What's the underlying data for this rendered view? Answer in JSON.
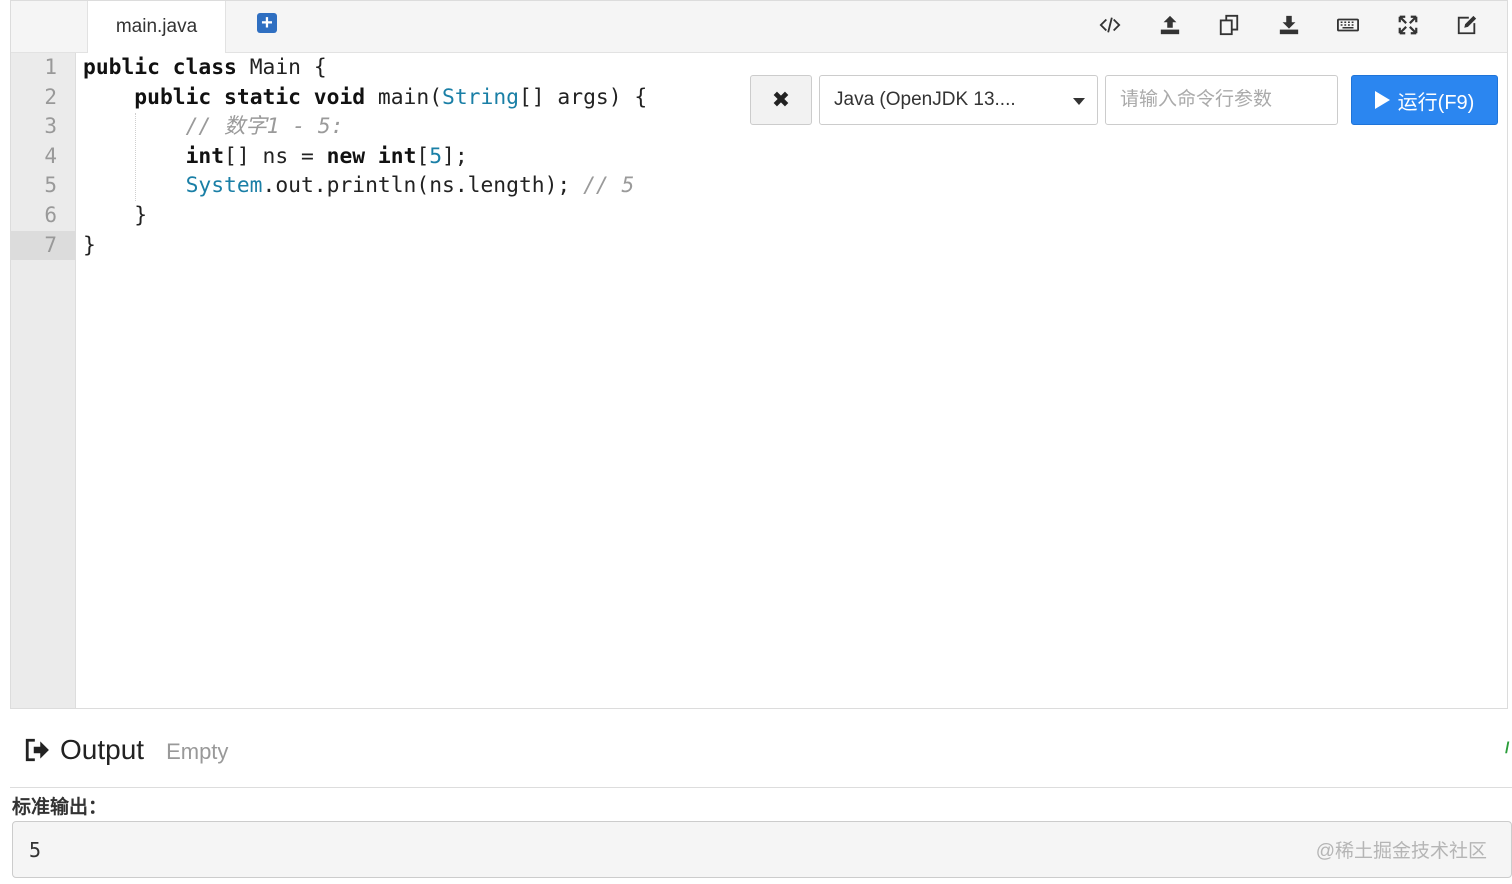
{
  "editor": {
    "tab_label": "main.java",
    "add_tab_icon": "plus-square-icon",
    "toolbar": [
      {
        "name": "code-embed-icon"
      },
      {
        "name": "upload-icon"
      },
      {
        "name": "copy-icon"
      },
      {
        "name": "download-icon"
      },
      {
        "name": "keyboard-icon"
      },
      {
        "name": "fullscreen-icon"
      },
      {
        "name": "edit-icon"
      }
    ],
    "line_numbers": [
      "1",
      "2",
      "3",
      "4",
      "5",
      "6",
      "7"
    ],
    "active_line": "7",
    "code_lines": [
      [
        {
          "t": "public class",
          "c": "kw"
        },
        {
          "t": " Main "
        },
        {
          "t": "{",
          "c": ""
        }
      ],
      [
        {
          "t": "    "
        },
        {
          "t": "public static void",
          "c": "kw"
        },
        {
          "t": " main("
        },
        {
          "t": "String",
          "c": "ty"
        },
        {
          "t": "[] args) {"
        }
      ],
      [
        {
          "t": "        "
        },
        {
          "t": "// 数字1 - 5:",
          "c": "cm"
        }
      ],
      [
        {
          "t": "        "
        },
        {
          "t": "int",
          "c": "kw"
        },
        {
          "t": "[] ns = "
        },
        {
          "t": "new",
          "c": "kw"
        },
        {
          "t": " "
        },
        {
          "t": "int",
          "c": "kw"
        },
        {
          "t": "["
        },
        {
          "t": "5",
          "c": "num"
        },
        {
          "t": "];"
        }
      ],
      [
        {
          "t": "        "
        },
        {
          "t": "System",
          "c": "ty"
        },
        {
          "t": ".out.println(ns.length); "
        },
        {
          "t": "// 5",
          "c": "cm"
        }
      ],
      [
        {
          "t": "    }"
        }
      ],
      [
        {
          "t": "}"
        }
      ]
    ]
  },
  "run_controls": {
    "close_label": "✖",
    "language": "Java (OpenJDK 13....",
    "args_placeholder": "请输入命令行参数",
    "args_value": "",
    "run_label": "运行(F9)"
  },
  "output": {
    "title": "Output",
    "status": "Empty",
    "stdout_label": "标准输出：",
    "stdout_value": "5",
    "watermark": "@稀土掘金技术社区"
  },
  "colors": {
    "run_button": "#2b86f0",
    "keyword": "#111111",
    "type": "#1a7fa6",
    "comment": "#9a9a9a"
  }
}
